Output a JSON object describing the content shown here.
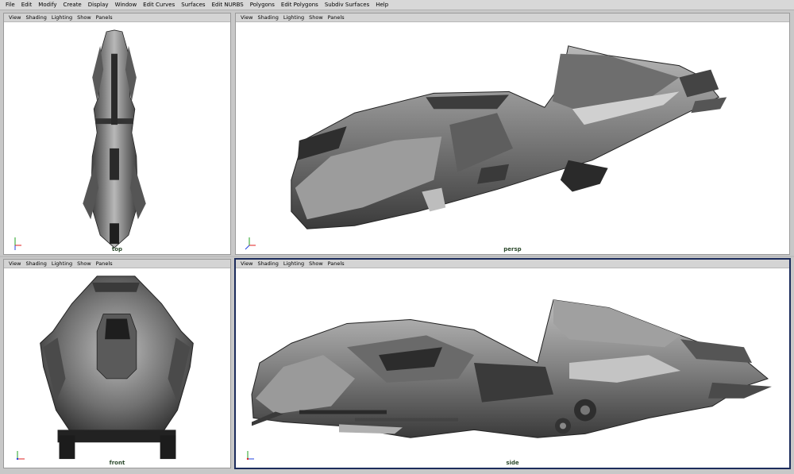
{
  "menubar": {
    "items": [
      "File",
      "Edit",
      "Modify",
      "Create",
      "Display",
      "Window",
      "Edit Curves",
      "Surfaces",
      "Edit NURBS",
      "Polygons",
      "Edit Polygons",
      "Subdiv Surfaces",
      "Help"
    ]
  },
  "panel_menu": [
    "View",
    "Shading",
    "Lighting",
    "Show",
    "Panels"
  ],
  "viewports": {
    "top": {
      "label": "top",
      "axes": [
        "Y",
        "X",
        "Z"
      ]
    },
    "persp": {
      "label": "persp",
      "axes": [
        "Y",
        "X",
        "Z"
      ]
    },
    "front": {
      "label": "front",
      "axes": [
        "Y",
        "X",
        "Z"
      ]
    },
    "side": {
      "label": "side",
      "axes": [
        "Y",
        "X",
        "Z"
      ]
    }
  },
  "colors": {
    "accent_active": "#1c2c5c",
    "axis_x": "#e02020",
    "axis_y": "#20a020",
    "axis_z": "#2040e0",
    "model_dark": "#3a3a3a",
    "model_mid": "#7c7c7c",
    "model_light": "#b4b4b4"
  }
}
